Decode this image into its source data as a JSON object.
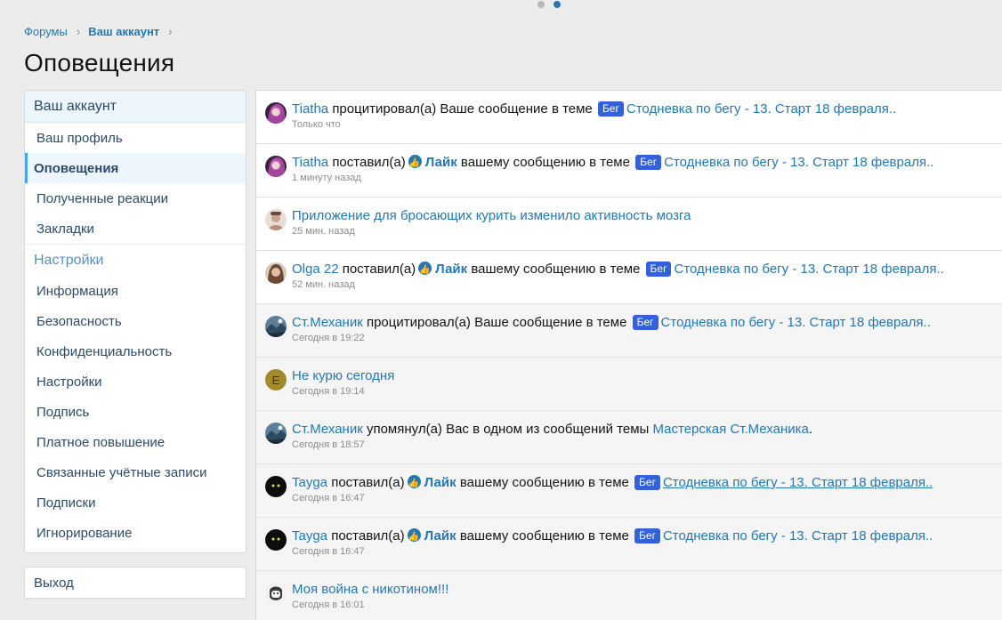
{
  "breadcrumb": {
    "forums": "Форумы",
    "account": "Ваш аккаунт"
  },
  "page_title": "Оповещения",
  "sidebar": {
    "header": "Ваш аккаунт",
    "items": [
      "Ваш профиль",
      "Оповещения",
      "Полученные реакции",
      "Закладки"
    ],
    "active_index": 1,
    "settings_title": "Настройки",
    "settings_items": [
      "Информация",
      "Безопасность",
      "Конфиденциальность",
      "Настройки",
      "Подпись",
      "Платное повышение",
      "Связанные учётные записи",
      "Подписки",
      "Игнорирование"
    ],
    "logout": "Выход"
  },
  "alerts": [
    {
      "user": "Tiatha",
      "action": "процитировал(а) Ваше сообщение в теме",
      "tag": "Бег",
      "thread": "Стодневка по бегу - 13. Старт 18 февраля..",
      "time": "Только что",
      "read": false,
      "avatar": "purple-hair"
    },
    {
      "user": "Tiatha",
      "action": "поставил(а)",
      "like": "Лайк",
      "action2": "вашему сообщению в теме",
      "tag": "Бег",
      "thread": "Стодневка по бегу - 13. Старт 18 февраля..",
      "time": "1 минуту назад",
      "read": false,
      "avatar": "purple-hair"
    },
    {
      "title": "Приложение для бросающих курить изменило активность мозга",
      "time": "25 мин. назад",
      "read": false,
      "avatar": "portrait"
    },
    {
      "user": "Olga 22",
      "action": "поставил(а)",
      "like": "Лайк",
      "action2": "вашему сообщению в теме",
      "tag": "Бег",
      "thread": "Стодневка по бегу - 13. Старт 18 февраля..",
      "time": "52 мин. назад",
      "read": false,
      "avatar": "brunette"
    },
    {
      "user": "Ст.Механик",
      "action": "процитировал(а) Ваше сообщение в теме",
      "tag": "Бег",
      "thread": "Стодневка по бегу - 13. Старт 18 февраля..",
      "time": "Сегодня в 19:22",
      "read": true,
      "avatar": "landscape"
    },
    {
      "title": "Не курю сегодня",
      "time": "Сегодня в 19:14",
      "read": true,
      "avatar": "letter",
      "avatar_letter": "E"
    },
    {
      "user": "Ст.Механик",
      "action": "упомянул(а) Вас в одном из сообщений темы",
      "thread": "Мастерская Ст.Механика",
      "suffix": ".",
      "time": "Сегодня в 18:57",
      "read": true,
      "avatar": "landscape"
    },
    {
      "user": "Tayga",
      "action": "поставил(а)",
      "like": "Лайк",
      "action2": "вашему сообщению в теме",
      "tag": "Бег",
      "thread": "Стодневка по бегу - 13. Старт 18 февраля..",
      "underline": true,
      "time": "Сегодня в 16:47",
      "read": true,
      "avatar": "dark"
    },
    {
      "user": "Tayga",
      "action": "поставил(а)",
      "like": "Лайк",
      "action2": "вашему сообщению в теме",
      "tag": "Бег",
      "thread": "Стодневка по бегу - 13. Старт 18 февраля..",
      "time": "Сегодня в 16:47",
      "read": true,
      "avatar": "dark"
    },
    {
      "title": "Моя война с никотином!!!",
      "time": "Сегодня в 16:01",
      "read": true,
      "avatar": "sketch"
    }
  ],
  "colors": {
    "link": "#2577b1",
    "tag_bg": "#3361d8",
    "active_bg": "#edf6fd",
    "active_border": "#47a7eb"
  }
}
